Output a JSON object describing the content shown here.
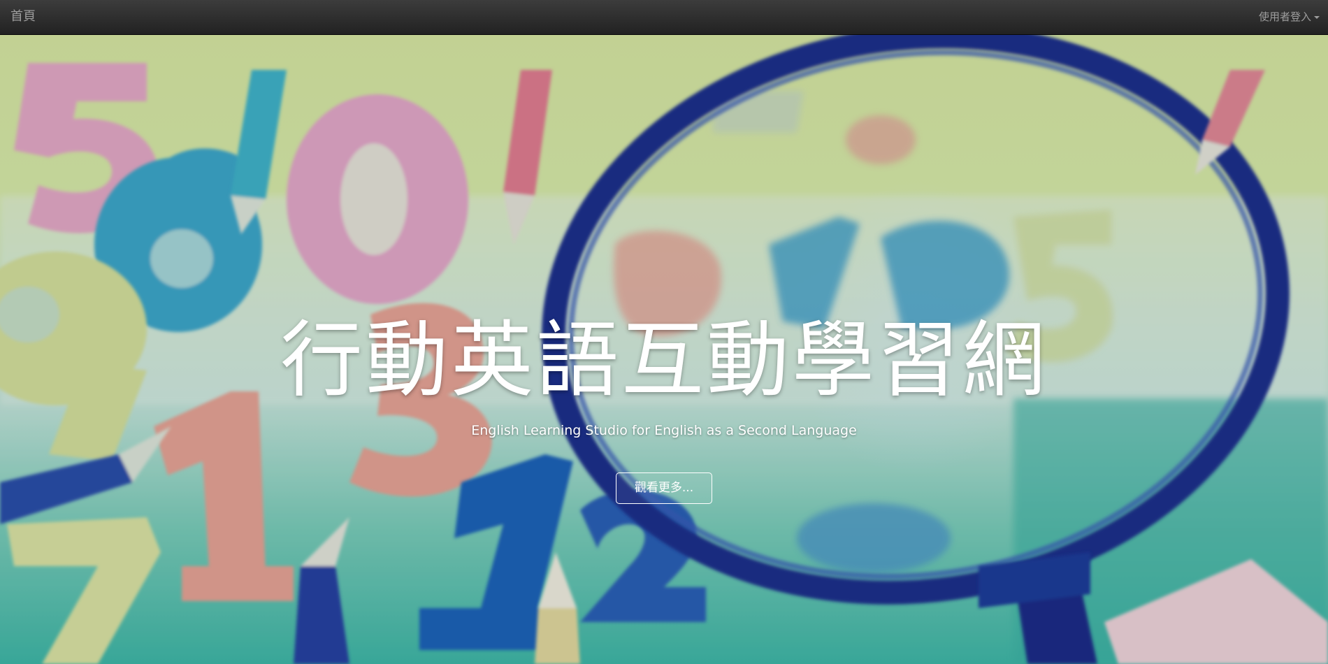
{
  "navbar": {
    "brand": "首頁",
    "user_menu": "使用者登入"
  },
  "hero": {
    "title": "行動英語互動學習網",
    "subtitle": "English Learning Studio for English as a Second Language",
    "button_label": "觀看更多...",
    "background_image": "colorful foam numbers and pencils with magnifying glass"
  },
  "colors": {
    "navbar_bg": "#222222",
    "navbar_text": "#9d9d9d",
    "hero_text": "#ffffff"
  }
}
